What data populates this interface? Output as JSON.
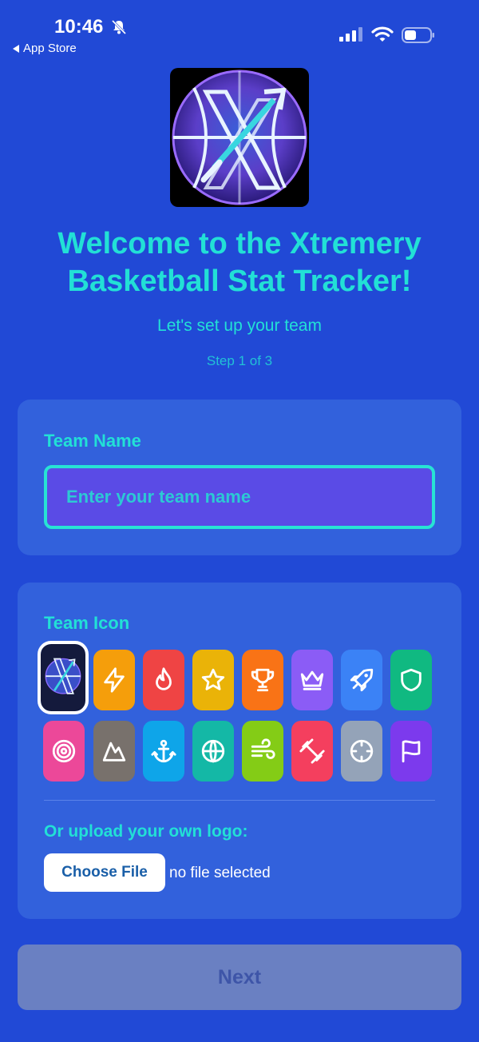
{
  "status": {
    "time": "10:46",
    "back_label": "App Store"
  },
  "header": {
    "title_line1": "Welcome to the Xtremery",
    "title_line2": "Basketball Stat Tracker!",
    "subtitle": "Let's set up your team",
    "step": "Step 1 of 3"
  },
  "team_name": {
    "label": "Team Name",
    "value": "",
    "placeholder": "Enter your team name"
  },
  "team_icon": {
    "label": "Team Icon",
    "selected_index": 0,
    "options": [
      {
        "name": "xtremery-logo",
        "color": "#141a3c"
      },
      {
        "name": "lightning",
        "color": "#f59e0b"
      },
      {
        "name": "flame",
        "color": "#ef4444"
      },
      {
        "name": "star",
        "color": "#eab308"
      },
      {
        "name": "trophy",
        "color": "#f97316"
      },
      {
        "name": "crown",
        "color": "#8b5cf6"
      },
      {
        "name": "rocket",
        "color": "#3b82f6"
      },
      {
        "name": "shield",
        "color": "#10b981"
      },
      {
        "name": "target",
        "color": "#ec4899"
      },
      {
        "name": "mountain",
        "color": "#78716c"
      },
      {
        "name": "anchor",
        "color": "#0ea5e9"
      },
      {
        "name": "globe",
        "color": "#14b8a6"
      },
      {
        "name": "wind",
        "color": "#84cc16"
      },
      {
        "name": "dumbbell",
        "color": "#f43f5e"
      },
      {
        "name": "crosshair",
        "color": "#94a3b8"
      },
      {
        "name": "flag",
        "color": "#7c3aed"
      }
    ]
  },
  "upload": {
    "label": "Or upload your own logo:",
    "button_label": "Choose File",
    "status_text": "no file selected"
  },
  "next_button": "Next",
  "colors": {
    "background": "#2149d6",
    "accent": "#22e0d6",
    "card": "#3261dc"
  }
}
